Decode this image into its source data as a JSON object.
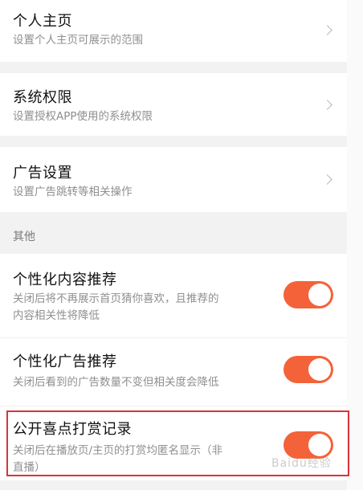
{
  "settings": {
    "items": [
      {
        "title": "个人主页",
        "subtitle": "设置个人主页可展示的范围"
      },
      {
        "title": "系统权限",
        "subtitle": "设置授权APP使用的系统权限"
      },
      {
        "title": "广告设置",
        "subtitle": "设置广告跳转等相关操作"
      }
    ],
    "section_other": "其他",
    "toggles": [
      {
        "title": "个性化内容推荐",
        "subtitle_line1": "关闭后将不再展示首页猜你喜欢，且推荐的",
        "subtitle_line2": "内容相关性将降低",
        "on": true
      },
      {
        "title": "个性化广告推荐",
        "subtitle_line1": "关闭后看到的广告数量不变但相关度会降低",
        "on": true
      },
      {
        "title": "公开喜点打赏记录",
        "subtitle_line1": "关闭后在播放页/主页的打赏均匿名显示（非",
        "subtitle_line2": "直播）",
        "on": true
      }
    ]
  },
  "watermark": "Baidu经验",
  "colors": {
    "accent": "#f4623a",
    "highlight": "#d9343b"
  }
}
